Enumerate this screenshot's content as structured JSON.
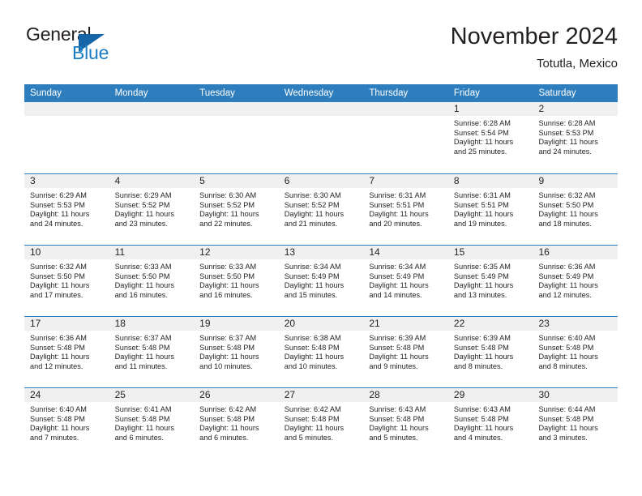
{
  "logo": {
    "word_one": "General",
    "word_two": "Blue",
    "triangle": "triangle-icon"
  },
  "header": {
    "title": "November 2024",
    "location": "Totutla, Mexico"
  },
  "calendar": {
    "weekday_headers": [
      "Sunday",
      "Monday",
      "Tuesday",
      "Wednesday",
      "Thursday",
      "Friday",
      "Saturday"
    ],
    "accent_color": "#2e7ebd",
    "daynum_band_color": "#f0f0f0",
    "weeks": [
      [
        {
          "day": "",
          "sunrise": "",
          "sunset": "",
          "daylight_line1": "",
          "daylight_line2": ""
        },
        {
          "day": "",
          "sunrise": "",
          "sunset": "",
          "daylight_line1": "",
          "daylight_line2": ""
        },
        {
          "day": "",
          "sunrise": "",
          "sunset": "",
          "daylight_line1": "",
          "daylight_line2": ""
        },
        {
          "day": "",
          "sunrise": "",
          "sunset": "",
          "daylight_line1": "",
          "daylight_line2": ""
        },
        {
          "day": "",
          "sunrise": "",
          "sunset": "",
          "daylight_line1": "",
          "daylight_line2": ""
        },
        {
          "day": "1",
          "sunrise": "Sunrise: 6:28 AM",
          "sunset": "Sunset: 5:54 PM",
          "daylight_line1": "Daylight: 11 hours",
          "daylight_line2": "and 25 minutes."
        },
        {
          "day": "2",
          "sunrise": "Sunrise: 6:28 AM",
          "sunset": "Sunset: 5:53 PM",
          "daylight_line1": "Daylight: 11 hours",
          "daylight_line2": "and 24 minutes."
        }
      ],
      [
        {
          "day": "3",
          "sunrise": "Sunrise: 6:29 AM",
          "sunset": "Sunset: 5:53 PM",
          "daylight_line1": "Daylight: 11 hours",
          "daylight_line2": "and 24 minutes."
        },
        {
          "day": "4",
          "sunrise": "Sunrise: 6:29 AM",
          "sunset": "Sunset: 5:52 PM",
          "daylight_line1": "Daylight: 11 hours",
          "daylight_line2": "and 23 minutes."
        },
        {
          "day": "5",
          "sunrise": "Sunrise: 6:30 AM",
          "sunset": "Sunset: 5:52 PM",
          "daylight_line1": "Daylight: 11 hours",
          "daylight_line2": "and 22 minutes."
        },
        {
          "day": "6",
          "sunrise": "Sunrise: 6:30 AM",
          "sunset": "Sunset: 5:52 PM",
          "daylight_line1": "Daylight: 11 hours",
          "daylight_line2": "and 21 minutes."
        },
        {
          "day": "7",
          "sunrise": "Sunrise: 6:31 AM",
          "sunset": "Sunset: 5:51 PM",
          "daylight_line1": "Daylight: 11 hours",
          "daylight_line2": "and 20 minutes."
        },
        {
          "day": "8",
          "sunrise": "Sunrise: 6:31 AM",
          "sunset": "Sunset: 5:51 PM",
          "daylight_line1": "Daylight: 11 hours",
          "daylight_line2": "and 19 minutes."
        },
        {
          "day": "9",
          "sunrise": "Sunrise: 6:32 AM",
          "sunset": "Sunset: 5:50 PM",
          "daylight_line1": "Daylight: 11 hours",
          "daylight_line2": "and 18 minutes."
        }
      ],
      [
        {
          "day": "10",
          "sunrise": "Sunrise: 6:32 AM",
          "sunset": "Sunset: 5:50 PM",
          "daylight_line1": "Daylight: 11 hours",
          "daylight_line2": "and 17 minutes."
        },
        {
          "day": "11",
          "sunrise": "Sunrise: 6:33 AM",
          "sunset": "Sunset: 5:50 PM",
          "daylight_line1": "Daylight: 11 hours",
          "daylight_line2": "and 16 minutes."
        },
        {
          "day": "12",
          "sunrise": "Sunrise: 6:33 AM",
          "sunset": "Sunset: 5:50 PM",
          "daylight_line1": "Daylight: 11 hours",
          "daylight_line2": "and 16 minutes."
        },
        {
          "day": "13",
          "sunrise": "Sunrise: 6:34 AM",
          "sunset": "Sunset: 5:49 PM",
          "daylight_line1": "Daylight: 11 hours",
          "daylight_line2": "and 15 minutes."
        },
        {
          "day": "14",
          "sunrise": "Sunrise: 6:34 AM",
          "sunset": "Sunset: 5:49 PM",
          "daylight_line1": "Daylight: 11 hours",
          "daylight_line2": "and 14 minutes."
        },
        {
          "day": "15",
          "sunrise": "Sunrise: 6:35 AM",
          "sunset": "Sunset: 5:49 PM",
          "daylight_line1": "Daylight: 11 hours",
          "daylight_line2": "and 13 minutes."
        },
        {
          "day": "16",
          "sunrise": "Sunrise: 6:36 AM",
          "sunset": "Sunset: 5:49 PM",
          "daylight_line1": "Daylight: 11 hours",
          "daylight_line2": "and 12 minutes."
        }
      ],
      [
        {
          "day": "17",
          "sunrise": "Sunrise: 6:36 AM",
          "sunset": "Sunset: 5:48 PM",
          "daylight_line1": "Daylight: 11 hours",
          "daylight_line2": "and 12 minutes."
        },
        {
          "day": "18",
          "sunrise": "Sunrise: 6:37 AM",
          "sunset": "Sunset: 5:48 PM",
          "daylight_line1": "Daylight: 11 hours",
          "daylight_line2": "and 11 minutes."
        },
        {
          "day": "19",
          "sunrise": "Sunrise: 6:37 AM",
          "sunset": "Sunset: 5:48 PM",
          "daylight_line1": "Daylight: 11 hours",
          "daylight_line2": "and 10 minutes."
        },
        {
          "day": "20",
          "sunrise": "Sunrise: 6:38 AM",
          "sunset": "Sunset: 5:48 PM",
          "daylight_line1": "Daylight: 11 hours",
          "daylight_line2": "and 10 minutes."
        },
        {
          "day": "21",
          "sunrise": "Sunrise: 6:39 AM",
          "sunset": "Sunset: 5:48 PM",
          "daylight_line1": "Daylight: 11 hours",
          "daylight_line2": "and 9 minutes."
        },
        {
          "day": "22",
          "sunrise": "Sunrise: 6:39 AM",
          "sunset": "Sunset: 5:48 PM",
          "daylight_line1": "Daylight: 11 hours",
          "daylight_line2": "and 8 minutes."
        },
        {
          "day": "23",
          "sunrise": "Sunrise: 6:40 AM",
          "sunset": "Sunset: 5:48 PM",
          "daylight_line1": "Daylight: 11 hours",
          "daylight_line2": "and 8 minutes."
        }
      ],
      [
        {
          "day": "24",
          "sunrise": "Sunrise: 6:40 AM",
          "sunset": "Sunset: 5:48 PM",
          "daylight_line1": "Daylight: 11 hours",
          "daylight_line2": "and 7 minutes."
        },
        {
          "day": "25",
          "sunrise": "Sunrise: 6:41 AM",
          "sunset": "Sunset: 5:48 PM",
          "daylight_line1": "Daylight: 11 hours",
          "daylight_line2": "and 6 minutes."
        },
        {
          "day": "26",
          "sunrise": "Sunrise: 6:42 AM",
          "sunset": "Sunset: 5:48 PM",
          "daylight_line1": "Daylight: 11 hours",
          "daylight_line2": "and 6 minutes."
        },
        {
          "day": "27",
          "sunrise": "Sunrise: 6:42 AM",
          "sunset": "Sunset: 5:48 PM",
          "daylight_line1": "Daylight: 11 hours",
          "daylight_line2": "and 5 minutes."
        },
        {
          "day": "28",
          "sunrise": "Sunrise: 6:43 AM",
          "sunset": "Sunset: 5:48 PM",
          "daylight_line1": "Daylight: 11 hours",
          "daylight_line2": "and 5 minutes."
        },
        {
          "day": "29",
          "sunrise": "Sunrise: 6:43 AM",
          "sunset": "Sunset: 5:48 PM",
          "daylight_line1": "Daylight: 11 hours",
          "daylight_line2": "and 4 minutes."
        },
        {
          "day": "30",
          "sunrise": "Sunrise: 6:44 AM",
          "sunset": "Sunset: 5:48 PM",
          "daylight_line1": "Daylight: 11 hours",
          "daylight_line2": "and 3 minutes."
        }
      ]
    ]
  }
}
